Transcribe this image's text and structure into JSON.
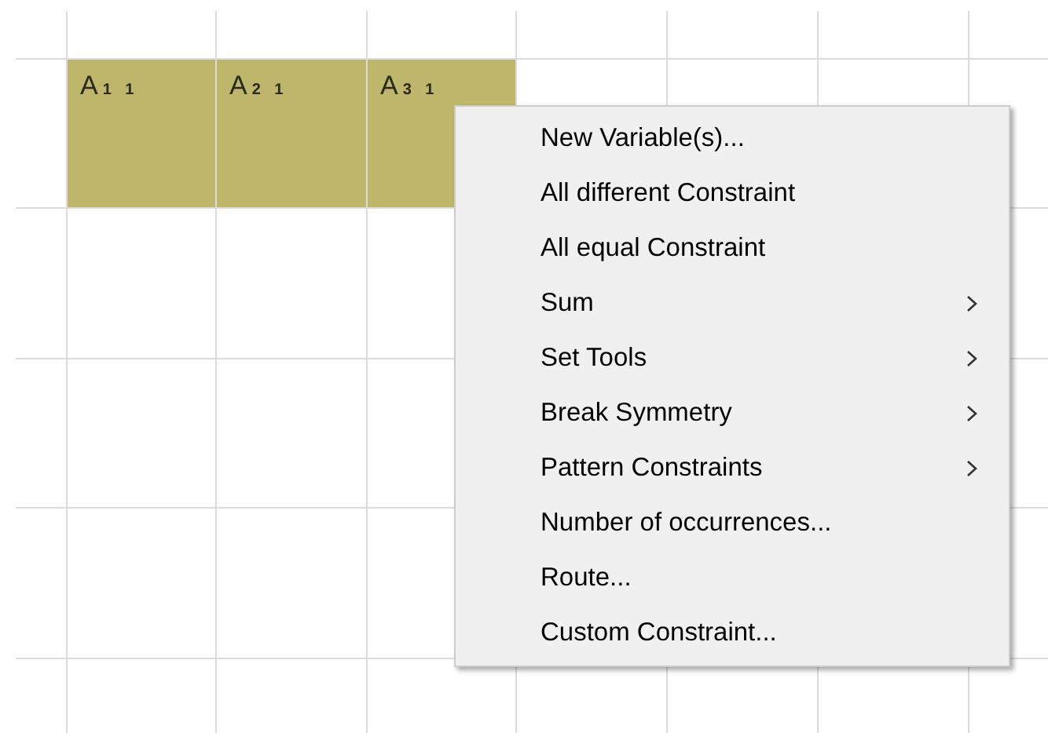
{
  "variables": [
    {
      "label": "A$_{1 1}$"
    },
    {
      "label": "A$_{2 1}$"
    },
    {
      "label": "A$_{3 1}$"
    }
  ],
  "context_menu": {
    "items": [
      {
        "label": "New Variable(s)...",
        "submenu": false
      },
      {
        "label": "All different Constraint",
        "submenu": false
      },
      {
        "label": "All equal Constraint",
        "submenu": false
      },
      {
        "label": "Sum",
        "submenu": true
      },
      {
        "label": "Set Tools",
        "submenu": true
      },
      {
        "label": "Break Symmetry",
        "submenu": true
      },
      {
        "label": "Pattern Constraints",
        "submenu": true
      },
      {
        "label": "Number of occurrences...",
        "submenu": false
      },
      {
        "label": "Route...",
        "submenu": false
      },
      {
        "label": "Custom Constraint...",
        "submenu": false
      }
    ]
  }
}
